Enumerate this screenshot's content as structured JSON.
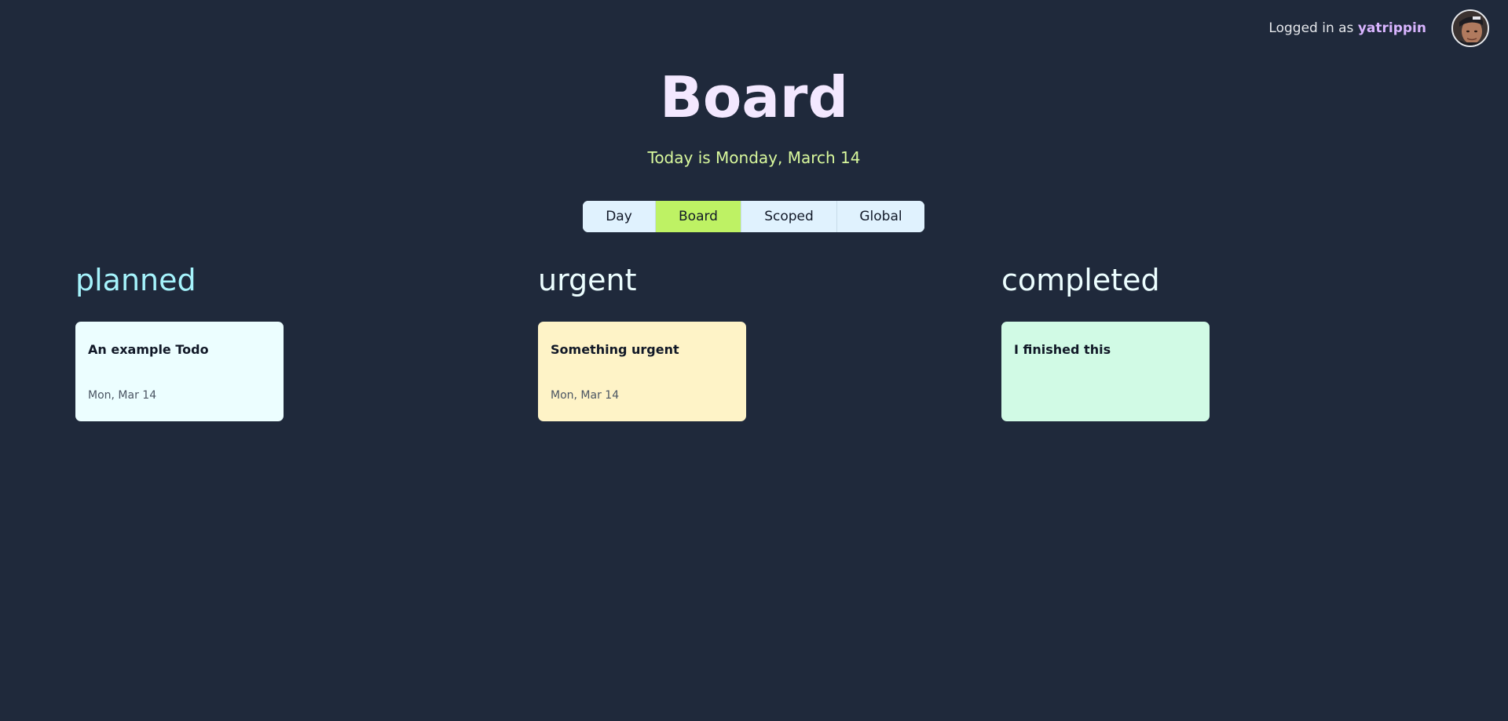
{
  "header": {
    "login_prefix": "Logged in as",
    "username": "yatrippin"
  },
  "page": {
    "title": "Board",
    "subtitle": "Today is Monday, March 14"
  },
  "tabs": [
    {
      "label": "Day",
      "active": false
    },
    {
      "label": "Board",
      "active": true
    },
    {
      "label": "Scoped",
      "active": false
    },
    {
      "label": "Global",
      "active": false
    }
  ],
  "columns": [
    {
      "heading": "planned",
      "color": "#a5f3fc",
      "cards": [
        {
          "title": "An example Todo",
          "date": "Mon, Mar 14",
          "color": "#ecfeff"
        }
      ]
    },
    {
      "heading": "urgent",
      "color": "#ecfeff",
      "cards": [
        {
          "title": "Something urgent",
          "date": "Mon, Mar 14",
          "color": "#fef3c7"
        }
      ]
    },
    {
      "heading": "completed",
      "color": "#ecfeff",
      "cards": [
        {
          "title": "I finished this",
          "date": "",
          "color": "#d1fae5"
        }
      ]
    }
  ],
  "colors": {
    "background": "#1f293b",
    "accent_active_tab": "#bef264",
    "tab_bg": "#e0f2fe",
    "title": "#f3e8ff",
    "subtitle": "#d9f99d",
    "username": "#d8b4fe"
  }
}
